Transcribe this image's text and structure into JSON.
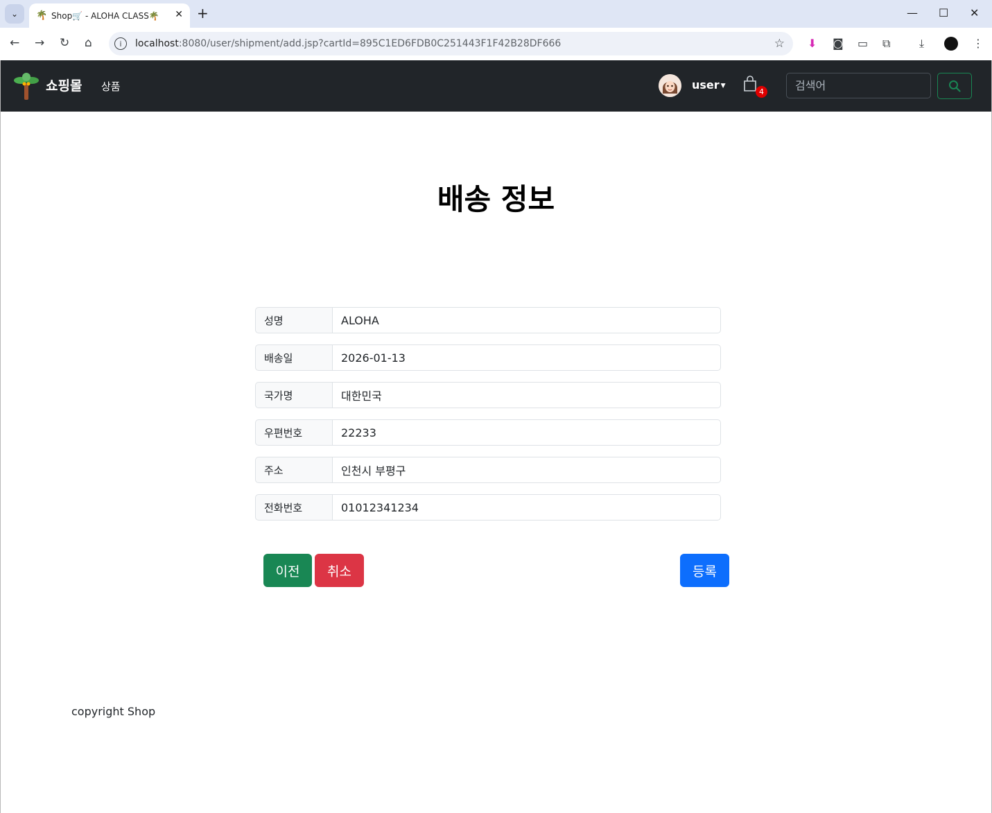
{
  "browser": {
    "tab_title": "Shop🛒 - ALOHA CLASS🌴",
    "url_host": "localhost",
    "url_rest": ":8080/user/shipment/add.jsp?cartId=895C1ED6FDB0C251443F1F42B28DF666"
  },
  "navbar": {
    "brand": "쇼핑몰",
    "products_link": "상품",
    "user_name": "user",
    "cart_count": "4",
    "search_placeholder": "검색어"
  },
  "page": {
    "title": "배송 정보"
  },
  "form": {
    "fields": [
      {
        "label": "성명",
        "value": "ALOHA"
      },
      {
        "label": "배송일",
        "value": "2026-01-13"
      },
      {
        "label": "국가명",
        "value": "대한민국"
      },
      {
        "label": "우편번호",
        "value": "22233"
      },
      {
        "label": "주소",
        "value": "인천시 부평구"
      },
      {
        "label": "전화번호",
        "value": "01012341234"
      }
    ],
    "buttons": {
      "prev": "이전",
      "cancel": "취소",
      "submit": "등록"
    }
  },
  "footer": {
    "text": "copyright Shop"
  },
  "colors": {
    "navbar_bg": "#212529",
    "success": "#198754",
    "danger": "#dc3545",
    "primary": "#0d6efd",
    "badge": "#e00000"
  }
}
